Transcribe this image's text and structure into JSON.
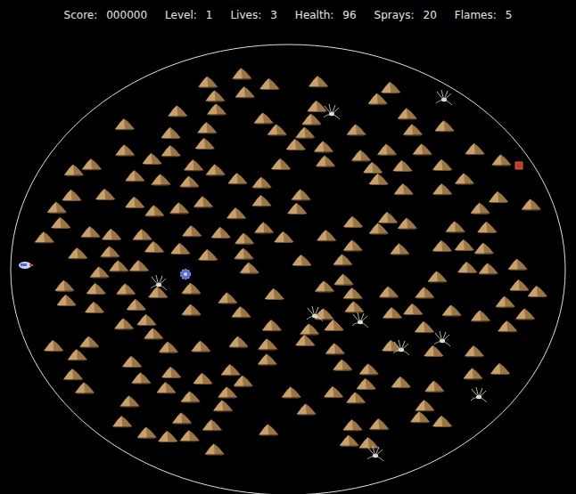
{
  "hud": [
    {
      "label": "Score:",
      "value": "000000"
    },
    {
      "label": "Level:",
      "value": "1"
    },
    {
      "label": "Lives:",
      "value": "3"
    },
    {
      "label": "Health:",
      "value": "96"
    },
    {
      "label": "Sprays:",
      "value": "20"
    },
    {
      "label": "Flames:",
      "value": "5"
    }
  ]
}
